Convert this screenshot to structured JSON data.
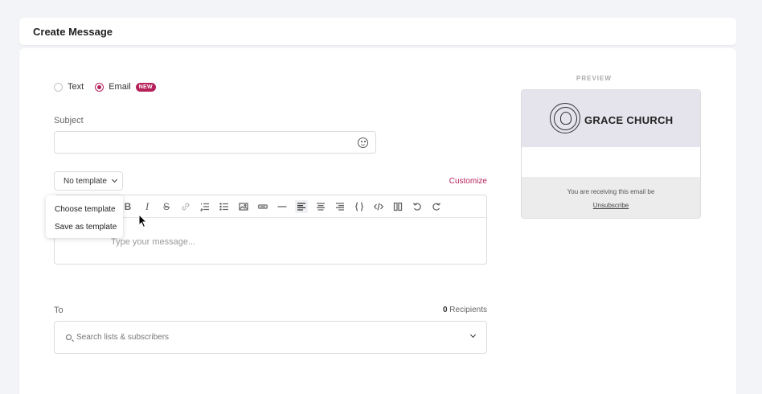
{
  "header": {
    "title": "Create Message"
  },
  "message_type": {
    "options": [
      {
        "label": "Text",
        "selected": false
      },
      {
        "label": "Email",
        "selected": true,
        "badge": "NEW"
      }
    ]
  },
  "subject": {
    "label": "Subject",
    "value": "",
    "emoji_icon": "emoji-smile-icon"
  },
  "template": {
    "button_label": "No template",
    "menu": [
      "Choose template",
      "Save as template"
    ]
  },
  "customize_label": "Customize",
  "editor": {
    "placeholder": "Type your message...",
    "toolbar": [
      "bold",
      "italic",
      "strikethrough",
      "link",
      "ordered-list",
      "bullet-list",
      "image",
      "button",
      "divider",
      "align-left",
      "align-center",
      "align-right",
      "variables",
      "code",
      "columns",
      "undo",
      "redo"
    ]
  },
  "recipients": {
    "label": "To",
    "count": "0",
    "count_label": "Recipients",
    "search_placeholder": "Search lists & subscribers"
  },
  "preview": {
    "label": "PREVIEW",
    "church_name": "GRACE CHURCH",
    "footer_text": "You are receiving this email be",
    "unsubscribe_label": "Unsubscribe"
  },
  "colors": {
    "accent": "#b5225a",
    "preview_header_bg": "#e5e3ec",
    "preview_footer_bg": "#ececec"
  }
}
